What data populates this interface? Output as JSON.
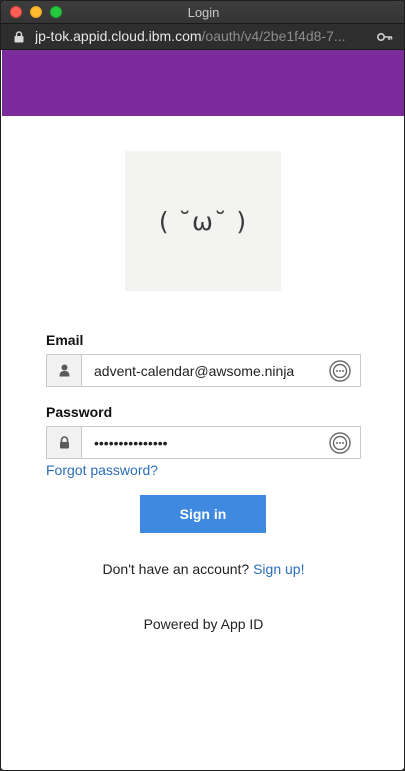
{
  "window": {
    "title": "Login",
    "url_host": "jp-tok.appid.cloud.ibm.com",
    "url_path": "/oauth/v4/2be1f4d8-7..."
  },
  "logo": {
    "text": "( ˘ω˘ )"
  },
  "form": {
    "email_label": "Email",
    "email_value": "advent-calendar@awsome.ninja",
    "password_label": "Password",
    "password_value": "•••••••••••••••",
    "forgot_link": "Forgot password?",
    "signin_label": "Sign in"
  },
  "signup": {
    "prompt": "Don't have an account?",
    "link": "Sign up!"
  },
  "footer": {
    "powered_by": "Powered by App ID"
  },
  "colors": {
    "brand": "#7b2b9c",
    "button": "#3f8ae0",
    "link": "#2a6ebb"
  },
  "icons": [
    "lock-icon",
    "key-icon",
    "user-icon",
    "password-lock-icon",
    "password-manager-icon"
  ]
}
